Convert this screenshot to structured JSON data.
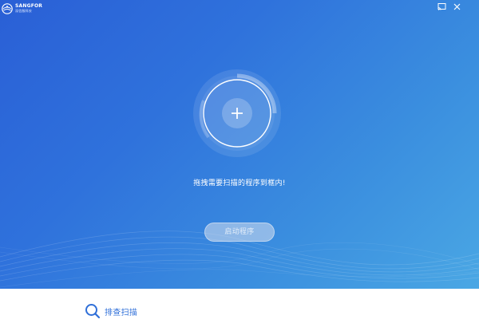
{
  "app": {
    "brand_name": "SANGFOR",
    "brand_sub": "深信服科技",
    "logo_icon": "globe-logo-icon"
  },
  "titlebar": {
    "cast_icon": "screen-cast-icon",
    "close_icon": "close-icon"
  },
  "main": {
    "drop_icon": "plus-icon",
    "hint": "拖拽需要扫描的程序到框内!",
    "start_label": "启动程序"
  },
  "footer": {
    "quarantine_icon": "search-icon",
    "quarantine_label": "排查扫描"
  },
  "colors": {
    "bg_start": "#2a5fd6",
    "bg_end": "#4aa7e4",
    "accent": "#2f6fd8"
  }
}
